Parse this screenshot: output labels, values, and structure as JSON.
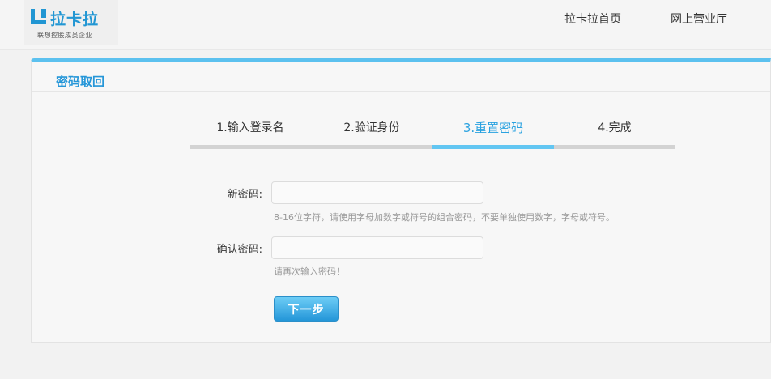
{
  "header": {
    "logo_text": "拉卡拉",
    "logo_subtext": "联想控股成员企业",
    "nav": [
      "拉卡拉首页",
      "网上营业厅"
    ]
  },
  "panel": {
    "title": "密码取回",
    "steps": [
      {
        "label": "1.输入登录名",
        "active": false
      },
      {
        "label": "2.验证身份",
        "active": false
      },
      {
        "label": "3.重置密码",
        "active": true
      },
      {
        "label": "4.完成",
        "active": false
      }
    ]
  },
  "form": {
    "new_password": {
      "label": "新密码:",
      "value": "",
      "hint": "8-16位字符，请使用字母加数字或符号的组合密码，不要单独使用数字，字母或符号。"
    },
    "confirm_password": {
      "label": "确认密码:",
      "value": "",
      "hint": "请再次输入密码！"
    },
    "next_button": "下一步"
  },
  "colors": {
    "accent": "#2596d8",
    "active_step": "#62c6f2",
    "inactive_step": "#d3d3d3"
  }
}
